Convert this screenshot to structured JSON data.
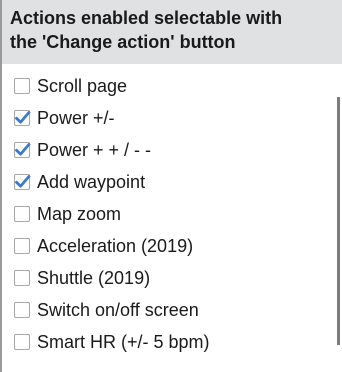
{
  "header": {
    "title_line1": "Actions enabled selectable with",
    "title_line2": "the 'Change action' button"
  },
  "actions": [
    {
      "label": "Scroll page",
      "checked": false
    },
    {
      "label": "Power +/-",
      "checked": true
    },
    {
      "label": "Power + + / - -",
      "checked": true
    },
    {
      "label": "Add waypoint",
      "checked": true
    },
    {
      "label": "Map zoom",
      "checked": false
    },
    {
      "label": "Acceleration (2019)",
      "checked": false
    },
    {
      "label": "Shuttle (2019)",
      "checked": false
    },
    {
      "label": "Switch on/off screen",
      "checked": false
    },
    {
      "label": "Smart HR (+/- 5 bpm)",
      "checked": false
    }
  ],
  "colors": {
    "header_bg": "#dfe1e3",
    "check_accent": "#3a7bd5",
    "scrollbar": "#7c7c7c"
  },
  "icons": {
    "checked": "checkmark-icon"
  }
}
